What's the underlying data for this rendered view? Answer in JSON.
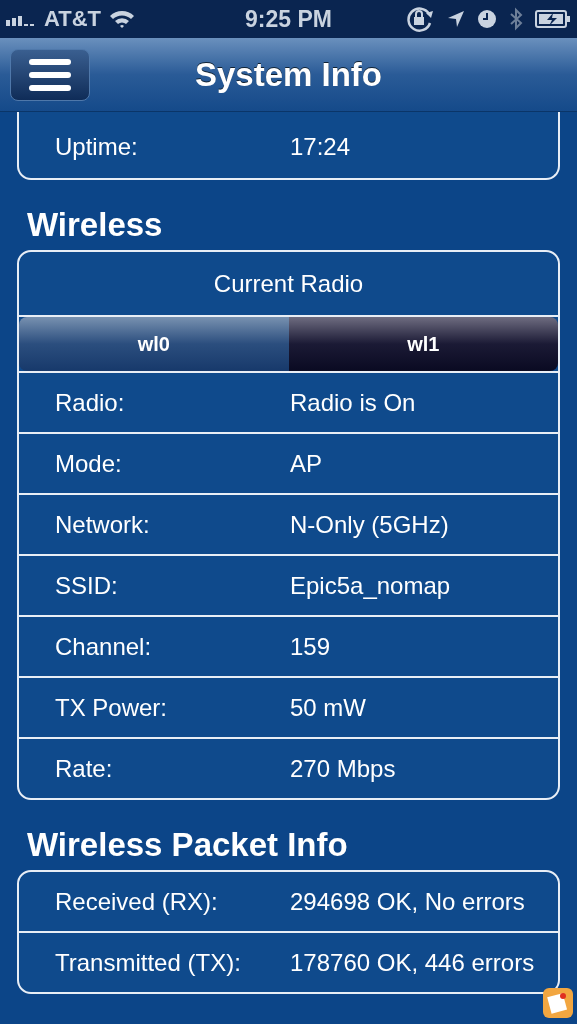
{
  "status_bar": {
    "carrier": "AT&T",
    "time": "9:25 PM"
  },
  "header": {
    "title": "System Info"
  },
  "system_rows": [
    {
      "label": "Uptime:",
      "value": "17:24"
    }
  ],
  "wireless": {
    "heading": "Wireless",
    "radio_title": "Current Radio",
    "radios": [
      {
        "label": "wl0",
        "selected": false
      },
      {
        "label": "wl1",
        "selected": true
      }
    ],
    "rows": [
      {
        "label": "Radio:",
        "value": "Radio is On"
      },
      {
        "label": "Mode:",
        "value": "AP"
      },
      {
        "label": "Network:",
        "value": "N-Only (5GHz)"
      },
      {
        "label": "SSID:",
        "value": "Epic5a_nomap"
      },
      {
        "label": "Channel:",
        "value": "159"
      },
      {
        "label": "TX Power:",
        "value": "50 mW"
      },
      {
        "label": "Rate:",
        "value": "270 Mbps"
      }
    ]
  },
  "packets": {
    "heading": "Wireless Packet Info",
    "rows": [
      {
        "label": "Received (RX):",
        "value": "294698 OK, No errors"
      },
      {
        "label": "Transmitted (TX):",
        "value": "178760 OK, 446 errors"
      }
    ]
  }
}
